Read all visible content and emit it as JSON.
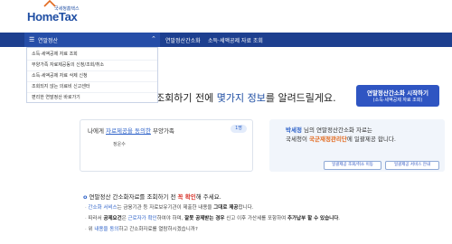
{
  "header": {
    "logo_sub": "국세청홈택스",
    "logo_main": "HomeTax"
  },
  "nav": {
    "active_label": "연말정산",
    "items": [
      "연말정산간소화",
      "소득·세액공제 자료 조회"
    ]
  },
  "dropdown": {
    "items": [
      "소득·세액공제 자료 조회",
      "부양가족 자료제공동의 신청/조회/취소",
      "소득·세액공제 자료 삭제 신청",
      "조회되지 않는 의료비 신고센터",
      "편리한 연말정산 바로가기"
    ]
  },
  "main": {
    "headline_pre": "조회하기 전에 ",
    "headline_highlight": "몇가지 정보",
    "headline_post": "를 알려드릴게요.",
    "start_button": {
      "title": "연말정산간소화 시작하기",
      "subtitle": "(소득·세액공제 자료 조회)"
    }
  },
  "left_panel": {
    "prefix": "나에게 ",
    "highlight": "자료제공을 동의한",
    "suffix": " 부양가족",
    "count": "1명",
    "dependent_name": "정운수"
  },
  "right_panel": {
    "user_name": "박세정",
    "line1_suffix": " 님의 연말정산간소화 자료는",
    "line2_prefix": "국세청이 ",
    "agency": "국군재정관리단",
    "line2_suffix": "에 일괄제공 합니다.",
    "buttons": [
      "일괄제공 조회/취소 이동",
      "일괄제공 서비스 안내"
    ]
  },
  "notice": {
    "title_pre": "연말정산 간소화자료를 조회하기 전 ",
    "title_red": "꼭 확인",
    "title_post": "해 주세요.",
    "row1_blue": "간소화 서비스",
    "row1_rest": "는 금융기관 등 자료보유기관이 제출한 내용을 ",
    "row1_bold": "그대로 제공",
    "row1_end": "합니다.",
    "row2_pre": "따라서 ",
    "row2_bold1": "공제요건",
    "row2_mid1": "은 ",
    "row2_blue": "근로자가 확인",
    "row2_mid2": "하여야 하며, ",
    "row2_bold2": "잘못 공제받는 경우",
    "row2_mid3": " 신고 이후 가산세를 포함하여 ",
    "row2_bold3": "추가납부 할 수 있습니다",
    "row2_end": ".",
    "row3_pre": "위 ",
    "row3_blue": "내용을 동의",
    "row3_rest": "하고 간소화자료를 열람하시겠습니까?"
  },
  "colors": {
    "nav_bg": "#1d3f8f",
    "accent": "#2f55c2",
    "highlight_blue": "#2f63c9",
    "warning_red": "#d9382f",
    "agency_orange": "#e26a1f"
  }
}
